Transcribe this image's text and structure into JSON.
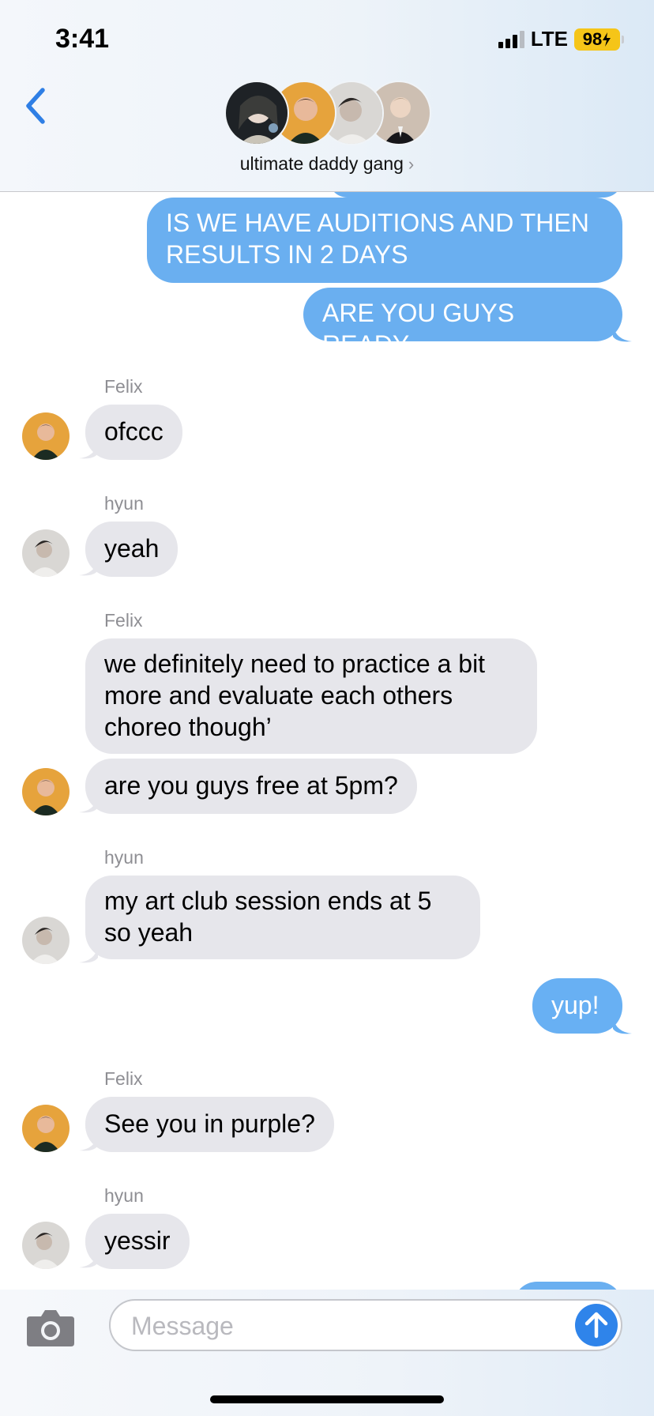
{
  "status_bar": {
    "time": "3:41",
    "network": "LTE",
    "battery": "98"
  },
  "header": {
    "group_name": "ultimate daddy gang",
    "chevron": "›",
    "avatars": [
      "member-1-avatar",
      "felix-avatar",
      "hyun-avatar",
      "member-4-avatar"
    ]
  },
  "thread": {
    "messages": [
      {
        "from": "me",
        "text": "IS WE HAVE AUDITIONS AND THEN RESULTS IN 2 DAYS"
      },
      {
        "from": "me",
        "text": "ARE YOU GUYS READY"
      },
      {
        "from": "Felix",
        "text": "ofccc"
      },
      {
        "from": "hyun",
        "text": "yeah"
      },
      {
        "from": "Felix",
        "text": "we definitely need to practice a bit more and evaluate each others choreo though’"
      },
      {
        "from": "Felix",
        "text": "are you guys free at 5pm?"
      },
      {
        "from": "hyun",
        "text": "my art club session ends at 5 so yeah"
      },
      {
        "from": "me",
        "text": "yup!"
      },
      {
        "from": "Felix",
        "text": "See you in purple?"
      },
      {
        "from": "hyun",
        "text": "yessir"
      }
    ],
    "sender_labels": [
      "Felix",
      "hyun",
      "Felix",
      "hyun",
      "Felix",
      "hyun"
    ]
  },
  "composer": {
    "placeholder": "Message"
  },
  "colors": {
    "sent_bubble": "#6aaff0",
    "received_bubble": "#e6e6eb",
    "accent": "#2f84ea",
    "battery": "#f5c518"
  }
}
